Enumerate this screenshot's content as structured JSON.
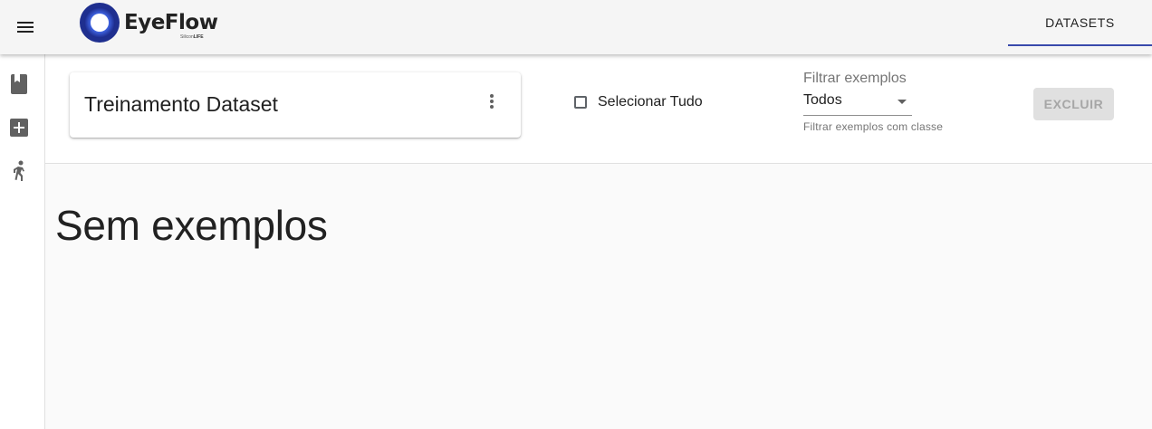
{
  "header": {
    "brand": "EyeFlow",
    "brand_sub_prefix": "Silicon",
    "brand_sub_suffix": "LIFE",
    "tabs": [
      {
        "label": "DATASETS",
        "active": true
      }
    ],
    "accent_color": "#3949ab"
  },
  "sidebar": {
    "items": [
      {
        "icon": "book-icon"
      },
      {
        "icon": "add-box-icon"
      },
      {
        "icon": "run-icon"
      }
    ]
  },
  "toolbar": {
    "dataset_title": "Treinamento Dataset",
    "select_all_label": "Selecionar Tudo",
    "select_all_checked": false,
    "filter": {
      "label": "Filtrar exemplos",
      "value": "Todos",
      "hint": "Filtrar exemplos com classe"
    },
    "delete_label": "EXCLUIR",
    "delete_enabled": false
  },
  "main": {
    "empty_message": "Sem exemplos"
  }
}
